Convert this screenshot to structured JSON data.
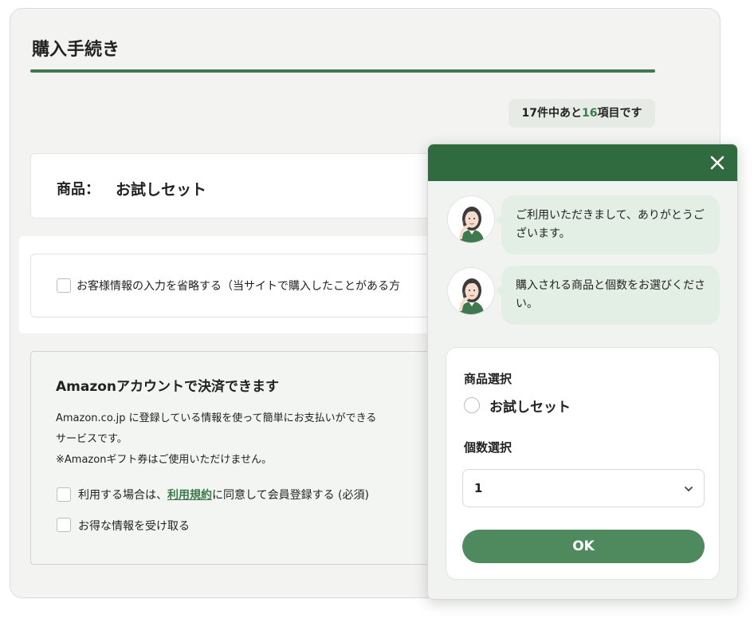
{
  "page": {
    "title": "購入手続き",
    "progress_prefix": "17件中あと",
    "progress_highlight": "16",
    "progress_suffix": "項目です"
  },
  "product": {
    "label": "商品：",
    "name": "お試しセット"
  },
  "skip_info": {
    "label": "お客様情報の入力を省略する（当サイトで購入したことがある方"
  },
  "amazon": {
    "title": "Amazonアカウントで決済できます",
    "desc_line1": "Amazon.co.jp に登録している情報を使って簡単にお支払いができる",
    "desc_line2": "サービスです。",
    "desc_line3": "※Amazonギフト券はご使用いただけません。",
    "agree_prefix": "利用する場合は、",
    "agree_link": "利用規約",
    "agree_suffix": "に同意して会員登録する (必須)",
    "newsletter_label": "お得な情報を受け取る"
  },
  "chat": {
    "close_symbol": "×",
    "messages": [
      {
        "text": "ご利用いただきまして、ありがとうございます。"
      },
      {
        "text": "購入される商品と個数をお選びください。"
      }
    ],
    "product_select_label": "商品選択",
    "product_option": "お試しセット",
    "quantity_label": "個数選択",
    "quantity_value": "1",
    "ok_label": "OK"
  },
  "colors": {
    "brand_green": "#2f6b3f",
    "accent_green": "#3f7a4e",
    "button_green": "#4f8a5e",
    "bubble_bg": "#e3efe5"
  },
  "icons": {
    "close": "close-icon",
    "chevron": "chevron-down-icon",
    "avatar": "operator-avatar-icon"
  }
}
